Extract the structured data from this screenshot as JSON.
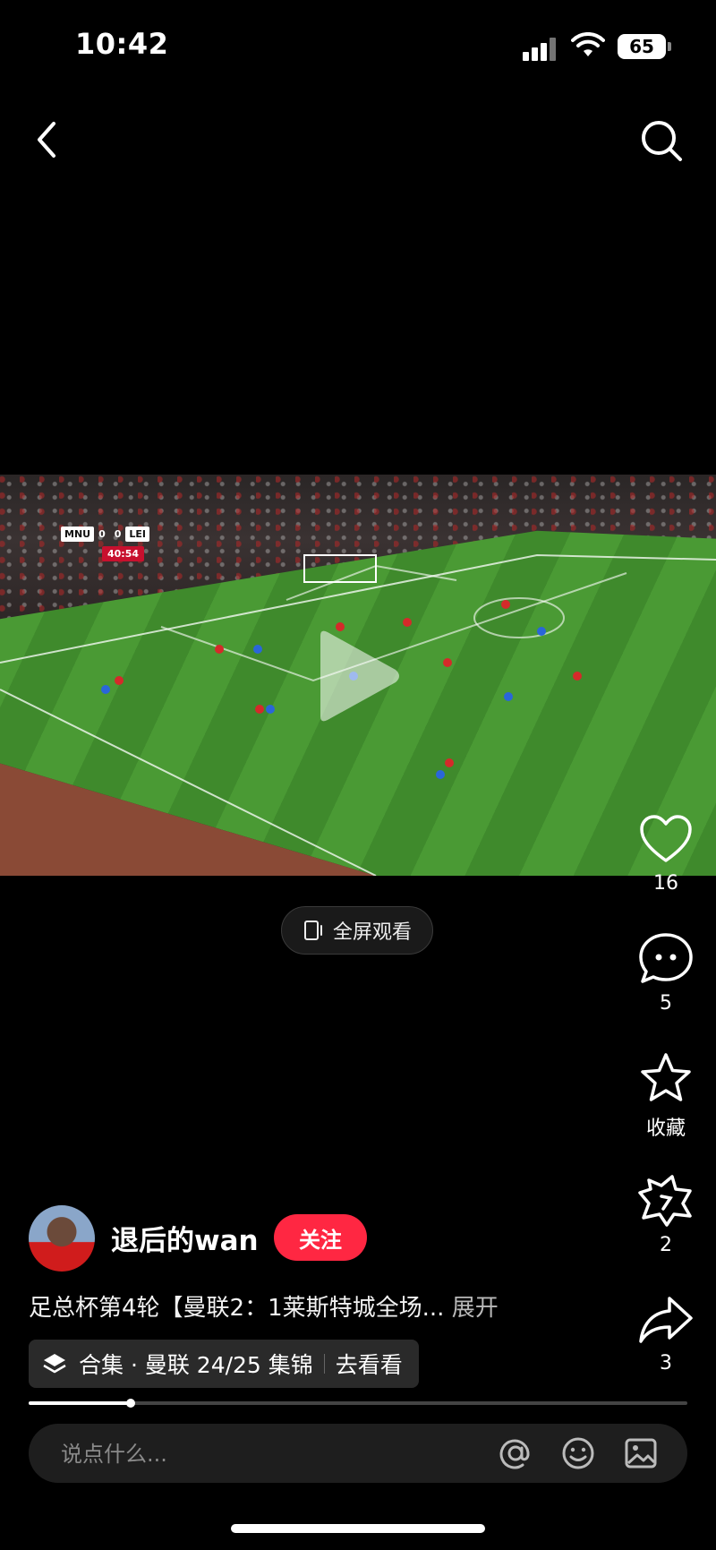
{
  "status_bar": {
    "time": "10:42",
    "battery": "65"
  },
  "video": {
    "scoreboard": {
      "home": "MNU",
      "home_score": "0",
      "away": "LEI",
      "away_score": "0",
      "clock": "40:54"
    },
    "fullscreen_label": "全屏观看"
  },
  "actions": {
    "like_count": "16",
    "comment_count": "5",
    "collect_label": "收藏",
    "gift_count": "2",
    "share_count": "3"
  },
  "author": {
    "name": "退后的wan",
    "follow_label": "关注"
  },
  "description": {
    "text": "足总杯第4轮【曼联2：1莱斯特城全场...",
    "expand_label": "展开"
  },
  "collection": {
    "label": "合集 · 曼联 24/25 集锦",
    "cta": "去看看"
  },
  "progress": {
    "fraction": 0.155
  },
  "comment": {
    "placeholder": "说点什么..."
  },
  "colors": {
    "accent": "#ff2742",
    "background": "#000000"
  },
  "icons": [
    "back-icon",
    "search-icon",
    "play-icon",
    "fullscreen-icon",
    "heart-icon",
    "comment-icon",
    "star-icon",
    "gift-icon",
    "share-icon",
    "layers-icon",
    "at-icon",
    "emoji-icon",
    "image-icon"
  ]
}
